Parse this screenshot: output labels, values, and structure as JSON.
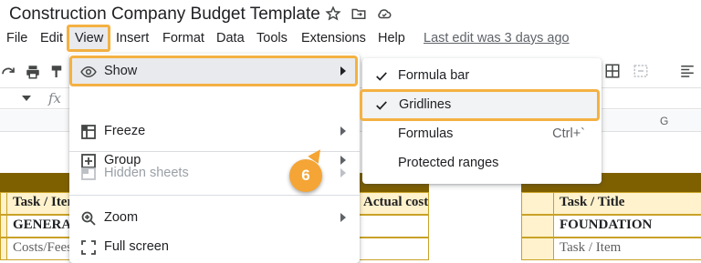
{
  "document": {
    "title": "Construction Company Budget Template"
  },
  "menubar": {
    "items": [
      "File",
      "Edit",
      "View",
      "Insert",
      "Format",
      "Data",
      "Tools",
      "Extensions",
      "Help"
    ],
    "last_edit": "Last edit was 3 days ago"
  },
  "formula_bar": {
    "fx": "fx"
  },
  "columns": {
    "g": "G"
  },
  "sheet": {
    "left_table": {
      "header": "Task  / Item",
      "row1": "GENERAL",
      "row2": "Costs/Fees",
      "right_header": "Actual cost"
    },
    "right_table": {
      "header": "Task  / Title",
      "row1": "FOUNDATION",
      "row2": "Task / Item"
    }
  },
  "view_menu": {
    "items": [
      {
        "label": "Show",
        "icon": "eye-icon"
      },
      {
        "label": "Freeze",
        "icon": "freeze-icon"
      },
      {
        "label": "Group",
        "icon": "group-icon"
      },
      {
        "label": "Hidden sheets",
        "icon": "hidden-sheets-icon"
      },
      {
        "label": "Zoom",
        "icon": "zoom-icon"
      },
      {
        "label": "Full screen",
        "icon": "fullscreen-icon"
      }
    ]
  },
  "show_submenu": {
    "items": [
      {
        "label": "Formula bar",
        "checked": true,
        "shortcut": ""
      },
      {
        "label": "Gridlines",
        "checked": true,
        "shortcut": ""
      },
      {
        "label": "Formulas",
        "checked": false,
        "shortcut": "Ctrl+`"
      },
      {
        "label": "Protected ranges",
        "checked": false,
        "shortcut": ""
      }
    ]
  },
  "callout": {
    "number": "6"
  },
  "colors": {
    "highlight": "#f4b142",
    "header_band": "#7f6000",
    "row_fill": "#fff2cc"
  }
}
